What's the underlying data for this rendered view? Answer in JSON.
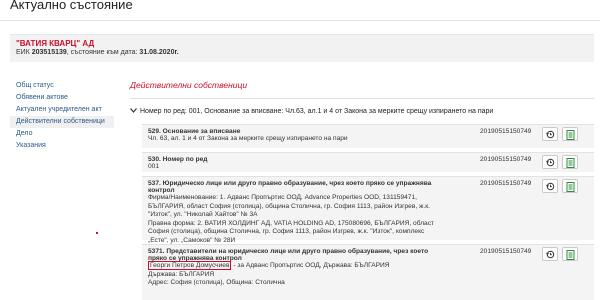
{
  "page": {
    "title": "Актуално състояние"
  },
  "company": {
    "name": "\"ВАТИЯ КВАРЦ\" АД",
    "eik_label": "ЕИК",
    "eik_value": "203515139",
    "state_label": ", състояние към дата:",
    "state_date": "31.08.2020г."
  },
  "sidebar": {
    "items": [
      {
        "label": "Общ статус"
      },
      {
        "label": "Обявени актове"
      },
      {
        "label": "Актуален учредителен акт"
      },
      {
        "label": "Действителни собственици"
      },
      {
        "label": "Дело"
      },
      {
        "label": "Указания"
      }
    ]
  },
  "main": {
    "section_title": "Действителни собственици",
    "group_header": "Номер по ред: 001, Основание за вписване: Чл.63, ал.1 и 4 от Закона за мерките срещу изпирането на пари",
    "rows": [
      {
        "title": "529. Основание за вписване",
        "lines": [
          "Чл. 63, ал. 1 и 4 от Закона за мерките срещу изпирането на пари"
        ],
        "date": "20190515150749"
      },
      {
        "title": "530. Номер по ред",
        "lines": [
          "001"
        ],
        "date": "20190515150749"
      },
      {
        "title": "537. Юридическо лице или друго правно образувание, чрез което пряко се упражнява контрол",
        "lines": [
          "Фирма/Наименование: 1. Адванс Пропъртис ООД, Advance Properties OOD, 131159471,",
          "БЪЛГАРИЯ, област София (столица), община Столична, гр. София 1113, район Изгрев, ж.к.",
          "\"Изток\", ул. \"Николай Хайтов\" № 3А",
          "Правна форма: 2. ВАТИЯ ХОЛДИНГ АД, VATIA HOLDING AD, 175080696, БЪЛГАРИЯ, област",
          "София (столица), община Столична, гр. София 1113, район Изгрев, ж.к. \"Изток\", комплекс",
          "„Есте\", ул. „Самоков\" № 28И"
        ],
        "date": "20190515150749"
      },
      {
        "title": "5371. Представители на юридическо лице или друго правно образувание, чрез което пряко се упражнява контрол",
        "highlight_name": "Георги Петров Домусчиев",
        "highlight_rest": " - за Адванс Пропъртис ООД, Държава: БЪЛГАРИЯ",
        "lines": [
          "Държава: БЪЛГАРИЯ",
          "Адрес: София (столица), Община: Столична"
        ],
        "date": "20190515150749"
      }
    ]
  },
  "icons": {
    "history": "history-icon",
    "document": "document-icon"
  },
  "colors": {
    "accent_red": "#c8102e",
    "link_blue": "#2a5a8a",
    "doc_green": "#2e8b3e"
  }
}
